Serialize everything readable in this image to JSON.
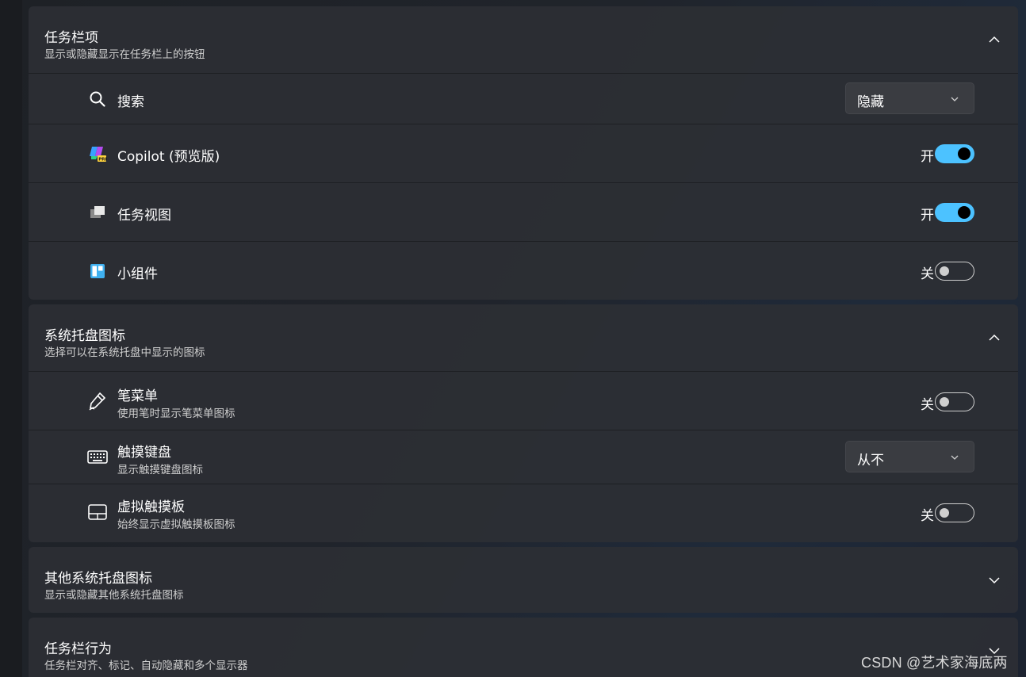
{
  "sections": [
    {
      "title": "任务栏项",
      "subtitle": "显示或隐藏显示在任务栏上的按钮",
      "expanded": true,
      "items": [
        {
          "label": "搜索",
          "icon": "search-icon",
          "control": "select",
          "value": "隐藏"
        },
        {
          "label": "Copilot (预览版)",
          "icon": "copilot-icon",
          "control": "toggle",
          "state_text": "开",
          "on": true
        },
        {
          "label": "任务视图",
          "icon": "task-view-icon",
          "control": "toggle",
          "state_text": "开",
          "on": true
        },
        {
          "label": "小组件",
          "icon": "widgets-icon",
          "control": "toggle",
          "state_text": "关",
          "on": false
        }
      ]
    },
    {
      "title": "系统托盘图标",
      "subtitle": "选择可以在系统托盘中显示的图标",
      "expanded": true,
      "items": [
        {
          "label": "笔菜单",
          "sublabel": "使用笔时显示笔菜单图标",
          "icon": "pen-icon",
          "control": "toggle",
          "state_text": "关",
          "on": false
        },
        {
          "label": "触摸键盘",
          "sublabel": "显示触摸键盘图标",
          "icon": "keyboard-icon",
          "control": "select",
          "value": "从不"
        },
        {
          "label": "虚拟触摸板",
          "sublabel": "始终显示虚拟触摸板图标",
          "icon": "touchpad-icon",
          "control": "toggle",
          "state_text": "关",
          "on": false
        }
      ]
    },
    {
      "title": "其他系统托盘图标",
      "subtitle": "显示或隐藏其他系统托盘图标",
      "expanded": false
    },
    {
      "title": "任务栏行为",
      "subtitle": "任务栏对齐、标记、自动隐藏和多个显示器",
      "expanded": false
    }
  ],
  "watermark": "CSDN @艺术家海底两",
  "colors": {
    "accent": "#4cc2ff",
    "card": "#2d2f34",
    "background": "#1e2126"
  }
}
